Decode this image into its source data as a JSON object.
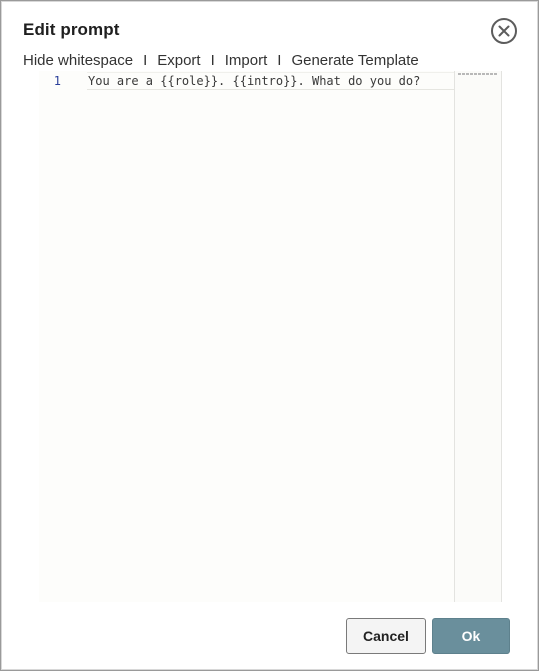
{
  "dialog": {
    "title": "Edit prompt"
  },
  "toolbar": {
    "items": [
      "Hide whitespace",
      "Export",
      "Import",
      "Generate Template"
    ],
    "separator": "I"
  },
  "editor": {
    "lines": [
      {
        "number": "1",
        "text": "You are a {{role}}. {{intro}}. What do you do?"
      }
    ]
  },
  "footer": {
    "cancel_label": "Cancel",
    "ok_label": "Ok"
  },
  "colors": {
    "ok_button": "#6a8f9c",
    "line_number": "#2a3f9a"
  },
  "icons": {
    "close": "close-circle-icon"
  }
}
